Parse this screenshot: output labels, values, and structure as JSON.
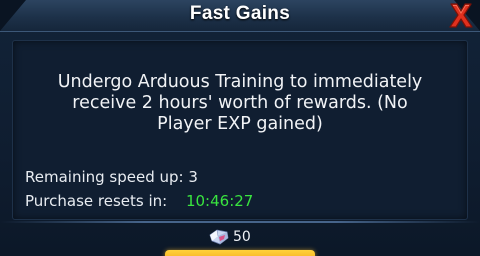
{
  "dialog": {
    "title": "Fast Gains",
    "close_icon": "close-x-icon",
    "close_color": "#e0301e"
  },
  "content": {
    "description": "Undergo Arduous Training to immediately receive 2 hours' worth of rewards. (No Player EXP gained)",
    "remaining_label": "Remaining speed up:",
    "remaining_value": "3",
    "resets_label": "Purchase resets in:",
    "resets_timer": "10:46:27",
    "timer_color": "#39e43f"
  },
  "cost": {
    "icon": "gem-icon",
    "value": "50"
  },
  "confirm_button": {
    "color": "#f3a41a"
  }
}
